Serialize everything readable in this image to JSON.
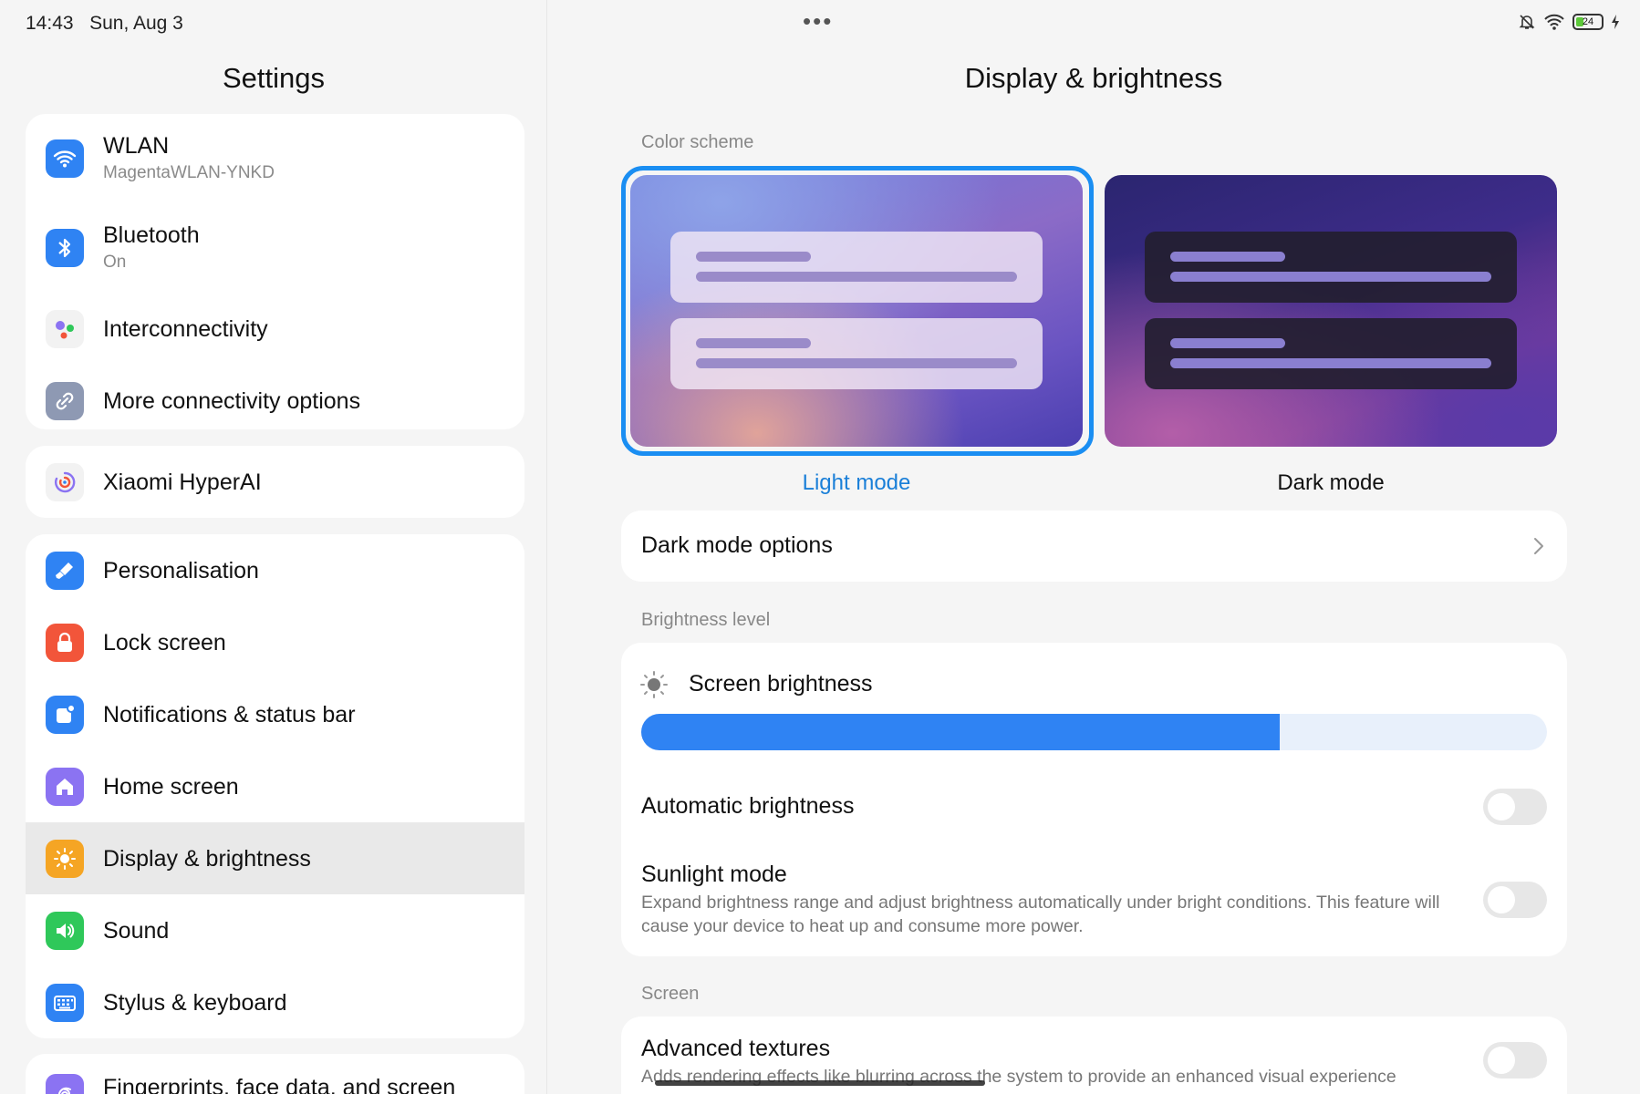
{
  "status_bar": {
    "time": "14:43",
    "date": "Sun, Aug 3",
    "battery": "24",
    "dots": "•••"
  },
  "left": {
    "title": "Settings",
    "groups": [
      [
        {
          "label": "WLAN",
          "sub": "MagentaWLAN-YNKD",
          "icon": "wifi-icon",
          "color": "#2f83f3"
        },
        {
          "label": "Bluetooth",
          "sub": "On",
          "icon": "bluetooth-icon",
          "color": "#2f83f3"
        },
        {
          "label": "Interconnectivity",
          "icon": "interconnectivity-icon",
          "color": "#f2f2f2"
        },
        {
          "label": "More connectivity options",
          "icon": "link-icon",
          "color": "#8e99b3"
        }
      ],
      [
        {
          "label": "Xiaomi HyperAI",
          "icon": "hyperai-icon",
          "color": "#f2f2f2"
        }
      ],
      [
        {
          "label": "Personalisation",
          "icon": "brush-icon",
          "color": "#2f83f3"
        },
        {
          "label": "Lock screen",
          "icon": "lock-icon",
          "color": "#f2553a"
        },
        {
          "label": "Notifications & status bar",
          "icon": "notification-icon",
          "color": "#2f83f3"
        },
        {
          "label": "Home screen",
          "icon": "home-icon",
          "color": "#8b73f2"
        },
        {
          "label": "Display & brightness",
          "icon": "sun-icon",
          "color": "#f5a524",
          "active": true
        },
        {
          "label": "Sound",
          "icon": "speaker-icon",
          "color": "#2fc85a"
        },
        {
          "label": "Stylus & keyboard",
          "icon": "keyboard-icon",
          "color": "#2f83f3"
        }
      ],
      [
        {
          "label": "Fingerprints, face data, and screen",
          "icon": "fingerprint-icon",
          "color": "#8b73f2"
        }
      ]
    ]
  },
  "right": {
    "title": "Display & brightness",
    "color_scheme_label": "Color scheme",
    "light_mode": "Light mode",
    "dark_mode": "Dark mode",
    "selected_scheme": "Light mode",
    "dark_mode_options": "Dark mode options",
    "brightness_level_label": "Brightness level",
    "screen_brightness": "Screen brightness",
    "brightness_value": 0.705,
    "automatic_brightness": "Automatic brightness",
    "automatic_brightness_on": false,
    "sunlight_mode": "Sunlight mode",
    "sunlight_mode_desc": "Expand brightness range and adjust brightness automatically under bright conditions. This feature will cause your device to heat up and consume more power.",
    "sunlight_mode_on": false,
    "screen_label": "Screen",
    "advanced_textures": "Advanced textures",
    "advanced_textures_desc": "Adds rendering effects like blurring across the system to provide an enhanced visual experience",
    "advanced_textures_on": false
  },
  "colors": {
    "accent": "#2f83f3",
    "selected_border": "#1a8ef2"
  }
}
